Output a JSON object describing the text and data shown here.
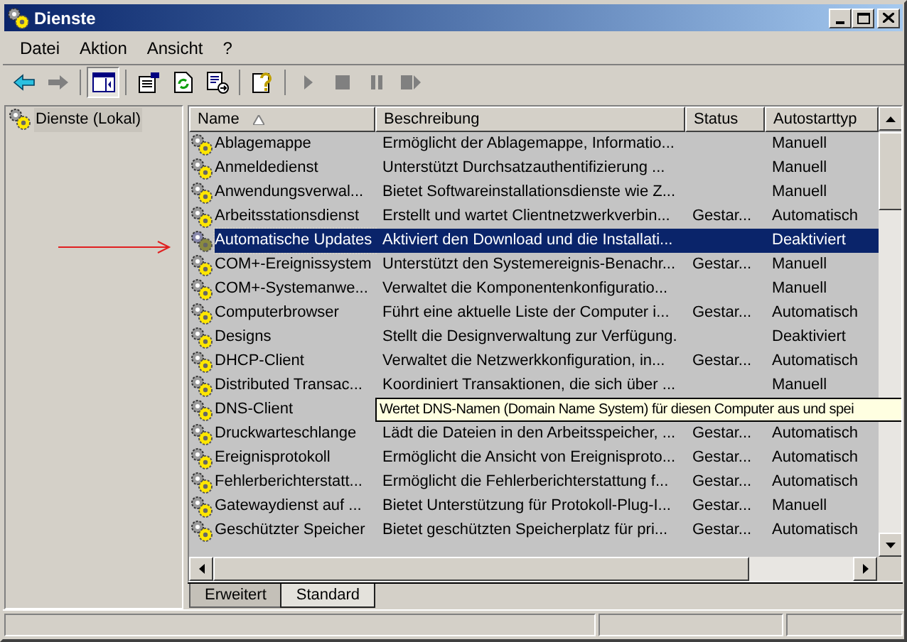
{
  "window": {
    "title": "Dienste"
  },
  "menu": [
    "Datei",
    "Aktion",
    "Ansicht",
    "?"
  ],
  "tree": {
    "label": "Dienste (Lokal)",
    "selected": true
  },
  "columns": [
    {
      "label": "Name",
      "sorted": true
    },
    {
      "label": "Beschreibung",
      "sorted": false
    },
    {
      "label": "Status",
      "sorted": false
    },
    {
      "label": "Autostarttyp",
      "sorted": false
    }
  ],
  "rows": [
    {
      "name": "Ablagemappe",
      "description": "Ermöglicht der Ablagemappe, Informatio...",
      "startup": "Manuell",
      "selected": false
    },
    {
      "name": "Anmeldedienst",
      "description": "Unterstützt Durchsatzauthentifizierung ...",
      "startup": "Manuell",
      "selected": false
    },
    {
      "name": "Anwendungsverwal...",
      "description": "Bietet Softwareinstallationsdienste wie Z...",
      "startup": "Manuell",
      "selected": false
    },
    {
      "name": "Arbeitsstationsdienst",
      "description": "Erstellt und wartet Clientnetzwerkverbin...",
      "status": "Gestar...",
      "startup": "Automatisch",
      "selected": false
    },
    {
      "name": "Automatische Updates",
      "description": "Aktiviert den Download und die Installati...",
      "startup": "Deaktiviert",
      "selected": true
    },
    {
      "name": "COM+-Ereignissystem",
      "description": "Unterstützt den Systemereignis-Benachr...",
      "status": "Gestar...",
      "startup": "Manuell",
      "selected": false
    },
    {
      "name": "COM+-Systemanwe...",
      "description": "Verwaltet die Komponentenkonfiguratio...",
      "startup": "Manuell",
      "selected": false
    },
    {
      "name": "Computerbrowser",
      "description": "Führt eine aktuelle Liste der Computer i...",
      "status": "Gestar...",
      "startup": "Automatisch",
      "selected": false
    },
    {
      "name": "Designs",
      "description": "Stellt die Designverwaltung zur Verfügung.",
      "startup": "Deaktiviert",
      "selected": false
    },
    {
      "name": "DHCP-Client",
      "description": "Verwaltet die Netzwerkkonfiguration, in...",
      "status": "Gestar...",
      "startup": "Automatisch",
      "selected": false
    },
    {
      "name": "Distributed Transac...",
      "description": "Koordiniert Transaktionen, die sich über ...",
      "startup": "Manuell",
      "selected": false
    },
    {
      "name": "DNS-Client",
      "selected": false
    },
    {
      "name": "Druckwarteschlange",
      "description": "Lädt die Dateien in den Arbeitsspeicher, ...",
      "status": "Gestar...",
      "startup": "Automatisch",
      "selected": false
    },
    {
      "name": "Ereignisprotokoll",
      "description": "Ermöglicht die Ansicht von Ereignisproto...",
      "status": "Gestar...",
      "startup": "Automatisch",
      "selected": false
    },
    {
      "name": "Fehlerberichterstatt...",
      "description": "Ermöglicht die Fehlerberichterstattung f...",
      "status": "Gestar...",
      "startup": "Automatisch",
      "selected": false
    },
    {
      "name": "Gatewaydienst auf ...",
      "description": "Bietet Unterstützung für Protokoll-Plug-I...",
      "status": "Gestar...",
      "startup": "Manuell",
      "selected": false
    },
    {
      "name": "Geschützter Speicher",
      "description": "Bietet geschützten Speicherplatz für pri...",
      "status": "Gestar...",
      "startup": "Automatisch",
      "selected": false
    }
  ],
  "tooltip": "Wertet DNS-Namen (Domain Name System) für diesen Computer aus und spei",
  "tabs": [
    {
      "label": "Erweitert",
      "selected": false
    },
    {
      "label": "Standard",
      "selected": true
    }
  ]
}
